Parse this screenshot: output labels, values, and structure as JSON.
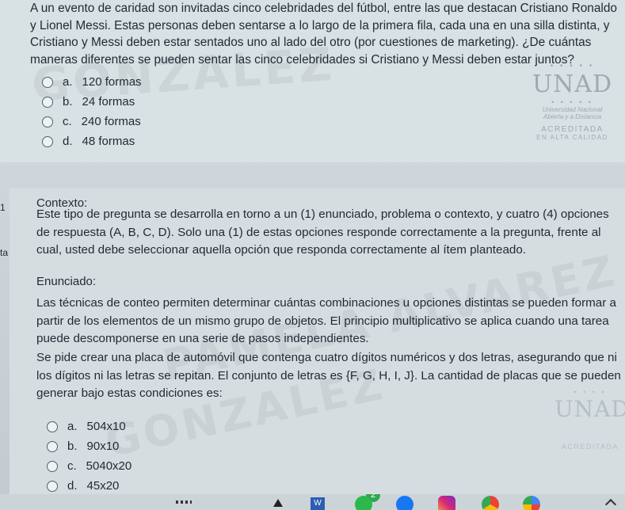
{
  "q1": {
    "text": "A un evento de caridad son invitadas cinco celebridades del fútbol, entre las que destacan Cristiano Ronaldo y Lionel Messi. Estas personas deben sentarse a lo largo de la primera fila, cada una en una silla distinta, y Cristiano y Messi deben estar sentados uno al lado del otro (por cuestiones de marketing). ¿De cuántas maneras diferentes se pueden sentar las cinco celebridades si Cristiano y Messi deben estar juntos?",
    "options": [
      {
        "letter": "a.",
        "text": "120 formas"
      },
      {
        "letter": "b.",
        "text": "24 formas"
      },
      {
        "letter": "c.",
        "text": "240 formas"
      },
      {
        "letter": "d.",
        "text": "48 formas"
      }
    ]
  },
  "logo": {
    "name": "UNAD",
    "line1": "Universidad Nacional",
    "line2": "Abierta y a Distancia",
    "acc1": "ACREDITADA",
    "acc2": "EN ALTA CALIDAD"
  },
  "side": {
    "a": "1",
    "b": "ta"
  },
  "q2": {
    "context_label": "Contexto:",
    "context_text": "Este tipo de pregunta se desarrolla en torno a un (1) enunciado, problema o contexto, y cuatro (4) opciones de respuesta (A, B, C, D). Solo una (1) de estas opciones responde correctamente a la pregunta, frente al cual, usted debe seleccionar aquella opción que responda correctamente al ítem planteado.",
    "statement_label": "Enunciado:",
    "statement_text1": "Las técnicas de conteo permiten determinar cuántas combinaciones u opciones distintas se pueden formar a partir de los elementos de un mismo grupo de objetos. El principio multiplicativo se aplica cuando una tarea puede descomponerse en una serie de pasos independientes.",
    "statement_text2": "Se pide crear una placa de automóvil que contenga cuatro dígitos numéricos y dos letras, asegurando que ni los dígitos ni las letras se repitan. El conjunto de letras es {F, G, H, I, J}. La cantidad de placas que se pueden generar bajo estas condiciones es:",
    "options": [
      {
        "letter": "a.",
        "text": "504x10"
      },
      {
        "letter": "b.",
        "text": "90x10"
      },
      {
        "letter": "c.",
        "text": "5040x20"
      },
      {
        "letter": "d.",
        "text": "45x20"
      }
    ]
  },
  "taskbar": {
    "badge": "2"
  }
}
